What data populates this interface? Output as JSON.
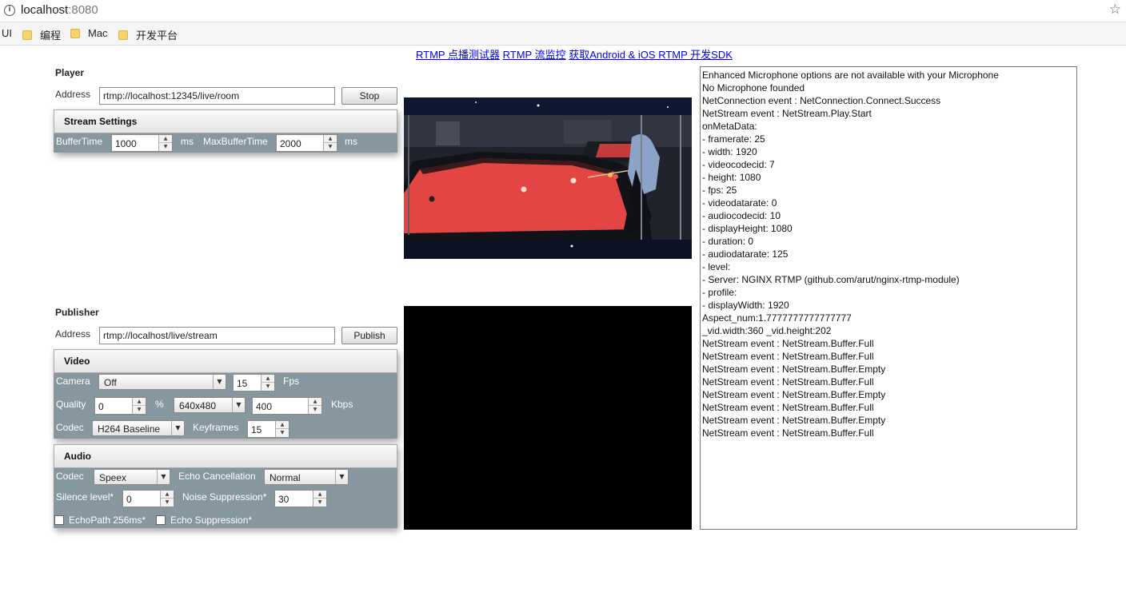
{
  "browser": {
    "url_host": "localhost",
    "url_port": ":8080",
    "bookmarks": [
      "UI",
      "编程",
      "Mac",
      "开发平台"
    ]
  },
  "toplinks": [
    "RTMP 点播测试器",
    "RTMP 流监控",
    "获取Android & iOS RTMP 开发SDK"
  ],
  "player": {
    "title": "Player",
    "address_label": "Address",
    "address_value": "rtmp://localhost:12345/live/room",
    "stop_label": "Stop",
    "stream_settings_title": "Stream Settings",
    "buffertime_label": "BufferTime",
    "buffertime_value": "1000",
    "ms1": "ms",
    "maxbuffertime_label": "MaxBufferTime",
    "maxbuffertime_value": "2000",
    "ms2": "ms"
  },
  "publisher": {
    "title": "Publisher",
    "address_label": "Address",
    "address_value": "rtmp://localhost/live/stream",
    "publish_label": "Publish",
    "video": {
      "title": "Video",
      "camera_label": "Camera",
      "camera_value": "Off",
      "fps_value": "15",
      "fps_label": "Fps",
      "quality_label": "Quality",
      "quality_value": "0",
      "percent": "%",
      "resolution_value": "640x480",
      "bitrate_value": "400",
      "kbps_label": "Kbps",
      "codec_label": "Codec",
      "codec_value": "H264 Baseline",
      "keyframes_label": "Keyframes",
      "keyframes_value": "15"
    },
    "audio": {
      "title": "Audio",
      "codec_label": "Codec",
      "codec_value": "Speex",
      "echo_label": "Echo Cancellation",
      "echo_value": "Normal",
      "silence_label": "Silence level*",
      "silence_value": "0",
      "noise_label": "Noise Suppression*",
      "noise_value": "30",
      "echopath_label": "EchoPath 256ms*",
      "echosupp_label": "Echo Suppression*"
    }
  },
  "log_lines": [
    "Enhanced Microphone options are not available with your Microphone",
    "No Microphone founded",
    "NetConnection event : NetConnection.Connect.Success",
    "NetStream event : NetStream.Play.Start",
    "onMetaData:",
    " - framerate: 25",
    " - width: 1920",
    " - videocodecid: 7",
    " - height: 1080",
    " - fps: 25",
    " - videodatarate: 0",
    " - audiocodecid: 10",
    " - displayHeight: 1080",
    " - duration: 0",
    " - audiodatarate: 125",
    " - level:",
    " - Server: NGINX RTMP (github.com/arut/nginx-rtmp-module)",
    " - profile:",
    " - displayWidth: 1920",
    "Aspect_num:1.7777777777777777",
    "_vid.width:360  _vid.height:202",
    "NetStream event : NetStream.Buffer.Full",
    "NetStream event : NetStream.Buffer.Full",
    "NetStream event : NetStream.Buffer.Empty",
    "NetStream event : NetStream.Buffer.Full",
    "NetStream event : NetStream.Buffer.Empty",
    "NetStream event : NetStream.Buffer.Full",
    "NetStream event : NetStream.Buffer.Empty",
    "NetStream event : NetStream.Buffer.Full"
  ]
}
